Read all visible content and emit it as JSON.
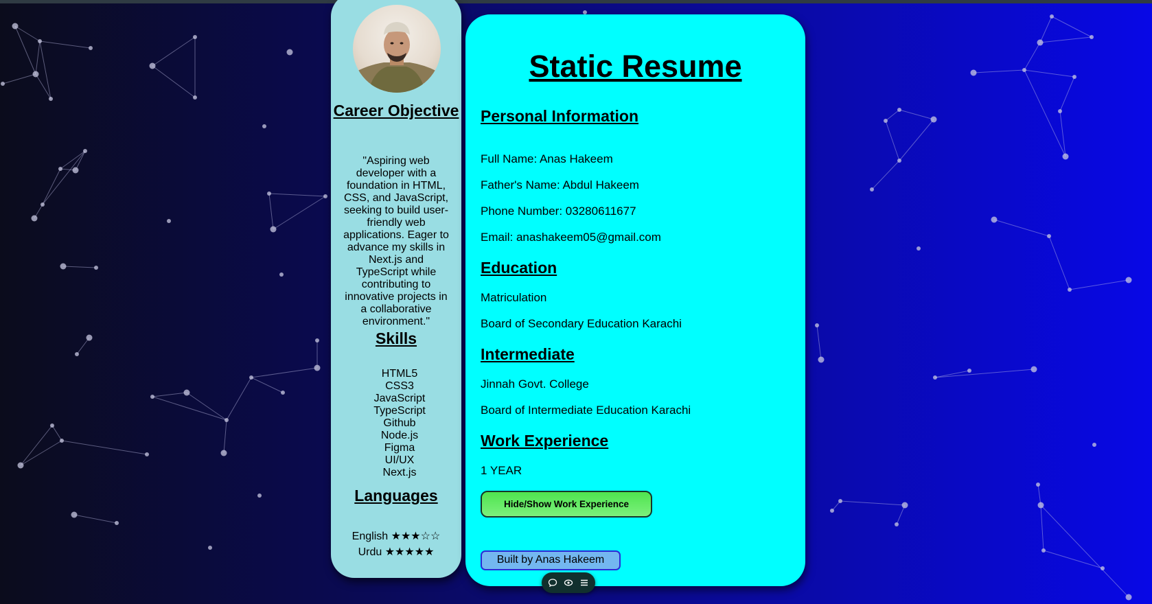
{
  "colors": {
    "sidebar_bg": "#99dde3",
    "main_bg": "#00ffff",
    "button_green": "#5ee85e",
    "built_badge_bg": "#73b7f0",
    "page_gradient": [
      "#0b0c1c",
      "#0808e6"
    ]
  },
  "sidebar": {
    "avatar_icon": "profile-photo",
    "career_heading": "Career Objective",
    "career_text": "\"Aspiring web developer with a foundation in HTML, CSS, and JavaScript, seeking to build user-friendly web applications. Eager to advance my skills in Next.js and TypeScript while contributing to innovative projects in a collaborative environment.\"",
    "skills_heading": "Skills",
    "skills": [
      "HTML5",
      "CSS3",
      "JavaScript",
      "TypeScript",
      "Github",
      "Node.js",
      "Figma",
      "UI/UX",
      "Next.js"
    ],
    "languages_heading": "Languages",
    "languages": [
      {
        "name": "English",
        "stars": "★★★☆☆",
        "rating": 3
      },
      {
        "name": "Urdu",
        "stars": "★★★★★",
        "rating": 5
      }
    ]
  },
  "main": {
    "title": "Static Resume",
    "personal_heading": "Personal Information",
    "full_name": "Full Name: Anas Hakeem",
    "father_name": "Father's Name: Abdul Hakeem",
    "phone": "Phone Number: 03280611677",
    "email": "Email: anashakeem05@gmail.com",
    "education_heading": "Education",
    "matric": "Matriculation",
    "matric_board": "Board of Secondary Education Karachi",
    "intermediate_heading": "Intermediate",
    "college": "Jinnah Govt. College",
    "inter_board": "Board of Intermediate Education Karachi",
    "work_heading": "Work Experience",
    "work_years": "1 YEAR",
    "toggle_button": "Hide/Show Work Experience",
    "built_by": "Built by Anas Hakeem"
  },
  "toolbar": {
    "icons": [
      "comment-icon",
      "eye-icon",
      "menu-icon"
    ]
  }
}
